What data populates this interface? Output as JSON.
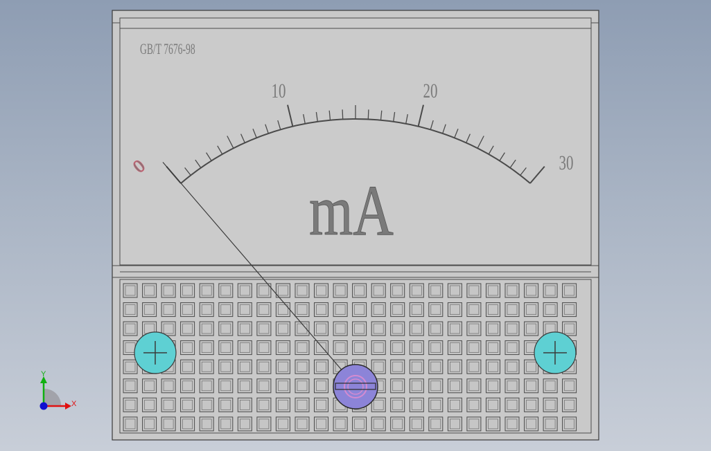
{
  "meter": {
    "standard_label": "GB/T 7676-98",
    "unit_label": "mA",
    "scale_labels": [
      "0",
      "10",
      "20",
      "30"
    ],
    "scale_min": 0,
    "scale_max": 30,
    "needle_value": 0
  },
  "triad": {
    "x_label": "X",
    "y_label": "Y",
    "x_color": "#e01010",
    "y_color": "#10b010",
    "z_color": "#1010d0"
  },
  "colors": {
    "panel_fill": "#c9c9c9",
    "line_color": "#4a4a4a",
    "screw_fill": "#5ed0d3",
    "adjuster_fill": "#8c84d8",
    "adjuster_inner": "#d48bd0"
  }
}
